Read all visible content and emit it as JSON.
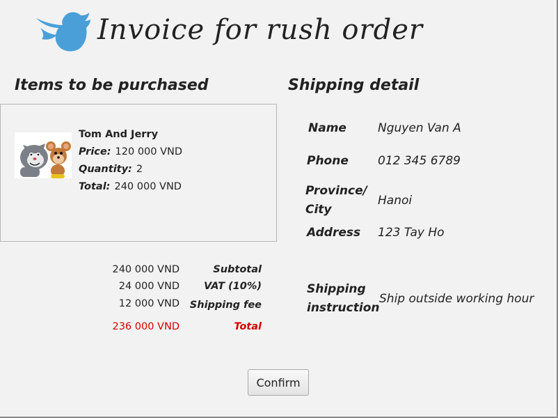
{
  "header": {
    "title": "Invoice for rush order",
    "logo_icon": "twitter-bird-icon",
    "brand_color": "#4a9fd8"
  },
  "items_section": {
    "title": "Items to be purchased",
    "item": {
      "name": "Tom And Jerry",
      "thumbnail_icon": "tom-and-jerry-image",
      "price_label": "Price:",
      "price": "120 000 VND",
      "quantity_label": "Quantity:",
      "quantity": "2",
      "total_label": "Total:",
      "total": "240 000 VND"
    }
  },
  "summary": {
    "subtotal_value": "240 000 VND",
    "subtotal_label": "Subtotal",
    "vat_value": "24 000 VND",
    "vat_label": "VAT (10%)",
    "shipping_value": "12 000 VND",
    "shipping_label": "Shipping fee",
    "total_value": "236 000 VND",
    "total_label": "Total",
    "total_color": "#d40000"
  },
  "shipping": {
    "title": "Shipping detail",
    "name_label": "Name",
    "name": "Nguyen Van A",
    "phone_label": "Phone",
    "phone": "012 345 6789",
    "province_label_1": "Province/",
    "province_label_2": "City",
    "province": "Hanoi",
    "address_label": "Address",
    "address": "123 Tay Ho",
    "instruction_label_1": "Shipping",
    "instruction_label_2": "instruction",
    "instruction": "Ship outside working hour"
  },
  "actions": {
    "confirm_label": "Confirm"
  }
}
